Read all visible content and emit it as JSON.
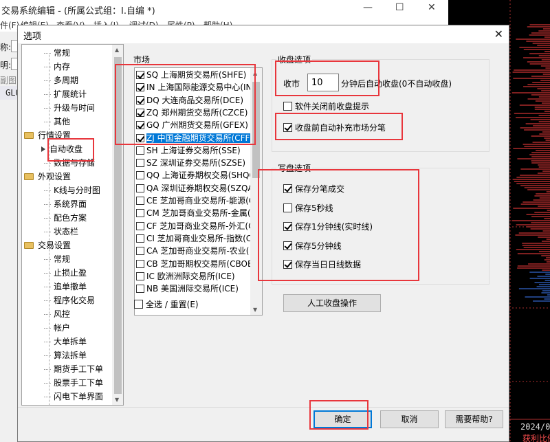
{
  "parent_window": {
    "title": "交易系统编辑 - (所属公式组：I.自编 *)",
    "menu": [
      "件(F)",
      "编辑(E)",
      "查看(V)",
      "插入(I)",
      "调试(D)",
      "属性(P)",
      "帮助(H)"
    ],
    "left_labels": [
      "称:",
      "明:",
      "副图"
    ],
    "code_text": "GLO",
    "minimize_glyph": "—",
    "maximize_glyph": "☐",
    "close_glyph": "✕"
  },
  "chart_bg": {
    "date": "2024/0",
    "subtitle": "获利比例"
  },
  "dialog": {
    "title": "选项",
    "close_glyph": "✕",
    "tree": [
      {
        "label": "常规",
        "level": 1
      },
      {
        "label": "内存",
        "level": 1
      },
      {
        "label": "多周期",
        "level": 1
      },
      {
        "label": "扩展统计",
        "level": 1
      },
      {
        "label": "升级与时间",
        "level": 1
      },
      {
        "label": "其他",
        "level": 1
      },
      {
        "label": "行情设置",
        "level": 0
      },
      {
        "label": "自动收盘",
        "level": 1,
        "selected": true
      },
      {
        "label": "数据与存储",
        "level": 1
      },
      {
        "label": "外观设置",
        "level": 0
      },
      {
        "label": "K线与分时图",
        "level": 1
      },
      {
        "label": "系统界面",
        "level": 1
      },
      {
        "label": "配色方案",
        "level": 1
      },
      {
        "label": "状态栏",
        "level": 1
      },
      {
        "label": "交易设置",
        "level": 0
      },
      {
        "label": "常规",
        "level": 1
      },
      {
        "label": "止损止盈",
        "level": 1
      },
      {
        "label": "追单撤单",
        "level": 1
      },
      {
        "label": "程序化交易",
        "level": 1
      },
      {
        "label": "风控",
        "level": 1
      },
      {
        "label": "帐户",
        "level": 1
      },
      {
        "label": "大单拆单",
        "level": 1
      },
      {
        "label": "算法拆单",
        "level": 1
      },
      {
        "label": "期货手工下单",
        "level": 1
      },
      {
        "label": "股票手工下单",
        "level": 1
      },
      {
        "label": "闪电下单界面",
        "level": 1
      }
    ],
    "market": {
      "label": "市场",
      "items": [
        {
          "label": "SQ 上海期货交易所(SHFE)",
          "checked": true
        },
        {
          "label": "IN 上海国际能源交易中心(IN",
          "checked": true
        },
        {
          "label": "DQ 大连商品交易所(DCE)",
          "checked": true
        },
        {
          "label": "ZQ 郑州期货交易所(CZCE)",
          "checked": true
        },
        {
          "label": "GQ 广州期货交易所(GFEX)",
          "checked": true
        },
        {
          "label": "ZJ 中国金融期货交易所(CFFE",
          "checked": true,
          "selected": true
        },
        {
          "label": "SH 上海证券交易所(SSE)",
          "checked": false
        },
        {
          "label": "SZ 深圳证券交易所(SZSE)",
          "checked": false
        },
        {
          "label": "QQ 上海证券期权交易(SHQO",
          "checked": false
        },
        {
          "label": "QA 深圳证券期权交易(SZQA",
          "checked": false
        },
        {
          "label": "CE 芝加哥商业交易所-能源(C",
          "checked": false
        },
        {
          "label": "CM 芝加哥商业交易所-金属(",
          "checked": false
        },
        {
          "label": "CF 芝加哥商业交易所-外汇(C",
          "checked": false
        },
        {
          "label": "CI 芝加哥商业交易所-指数(C",
          "checked": false
        },
        {
          "label": "CA 芝加哥商业交易所-农业(",
          "checked": false
        },
        {
          "label": "CB 芝加哥期权交易所(CBOE",
          "checked": false
        },
        {
          "label": "IC 欧洲洲际交易所(ICE)",
          "checked": false
        },
        {
          "label": "NB 美国洲际交易所(ICE)",
          "checked": false
        }
      ],
      "select_all_label": "全选 / 重置(E)",
      "select_all_checked": false
    },
    "close_section": {
      "title": "收盘选项",
      "prefix": "收市",
      "minutes_value": "10",
      "suffix": "分钟后自动收盘(0不自动收盘)",
      "options": [
        {
          "label": "软件关闭前收盘提示",
          "checked": false
        },
        {
          "label": "收盘前自动补充市场分笔",
          "checked": true
        }
      ]
    },
    "write_section": {
      "title": "写盘选项",
      "options": [
        {
          "label": "保存分笔成交",
          "checked": true
        },
        {
          "label": "保存5秒线",
          "checked": false
        },
        {
          "label": "保存1分钟线(实时线)",
          "checked": true
        },
        {
          "label": "保存5分钟线",
          "checked": true
        },
        {
          "label": "保存当日日线数据",
          "checked": true
        }
      ]
    },
    "manual_close_button": "人工收盘操作",
    "buttons": {
      "ok": "确定",
      "cancel": "取消",
      "help": "需要帮助?"
    }
  }
}
